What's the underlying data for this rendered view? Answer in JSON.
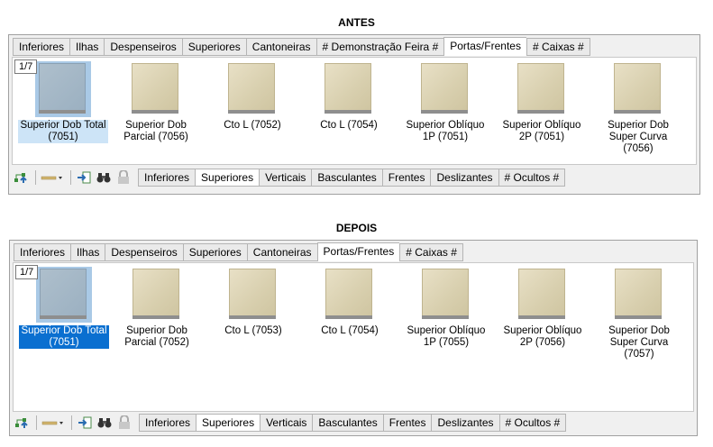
{
  "before": {
    "title": "ANTES",
    "tabs": [
      "Inferiores",
      "Ilhas",
      "Despenseiros",
      "Superiores",
      "Cantoneiras",
      "# Demonstração Feira #",
      "Portas/Frentes",
      "# Caixas #"
    ],
    "active_tab": 6,
    "page_indicator": "1/7",
    "items": [
      {
        "label": "Superior Dob Total (7051)",
        "selected": true
      },
      {
        "label": "Superior Dob Parcial (7056)"
      },
      {
        "label": "Cto L (7052)"
      },
      {
        "label": "Cto L (7054)"
      },
      {
        "label": "Superior Oblíquo 1P (7051)"
      },
      {
        "label": "Superior Oblíquo 2P (7051)"
      },
      {
        "label": "Superior Dob Super Curva (7056)"
      }
    ],
    "bottom_tabs": [
      "Inferiores",
      "Superiores",
      "Verticais",
      "Basculantes",
      "Frentes",
      "Deslizantes",
      "# Ocultos #"
    ],
    "active_bottom_tab": 1
  },
  "after": {
    "title": "DEPOIS",
    "tabs": [
      "Inferiores",
      "Ilhas",
      "Despenseiros",
      "Superiores",
      "Cantoneiras",
      "Portas/Frentes",
      "# Caixas #"
    ],
    "active_tab": 5,
    "page_indicator": "1/7",
    "items": [
      {
        "label": "Superior Dob Total (7051)",
        "selected": true
      },
      {
        "label": "Superior Dob Parcial (7052)"
      },
      {
        "label": "Cto L (7053)"
      },
      {
        "label": "Cto L (7054)"
      },
      {
        "label": "Superior Oblíquo 1P (7055)"
      },
      {
        "label": "Superior Oblíquo 2P (7056)"
      },
      {
        "label": "Superior Dob Super Curva (7057)"
      }
    ],
    "bottom_tabs": [
      "Inferiores",
      "Superiores",
      "Verticais",
      "Basculantes",
      "Frentes",
      "Deslizantes",
      "# Ocultos #"
    ],
    "active_bottom_tab": 1
  },
  "toolbar_icons": [
    "tree-up-icon",
    "line-style-icon",
    "import-icon",
    "binoculars-icon",
    "lock-icon"
  ],
  "colors": {
    "selection": "#0a6fd0",
    "selection_light": "#cde4f7",
    "panel_bg": "#f0f0f0"
  }
}
